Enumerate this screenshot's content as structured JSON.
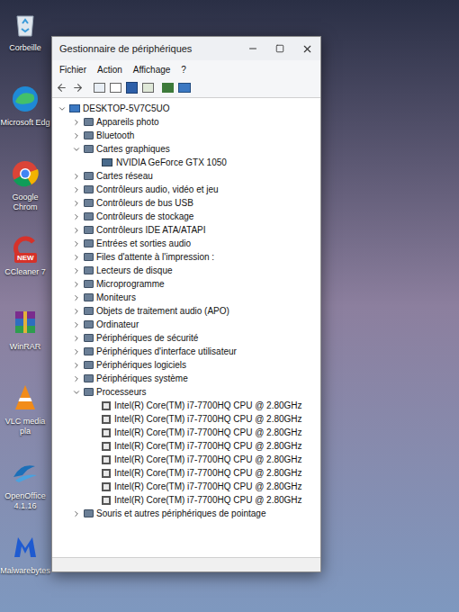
{
  "desktop": {
    "icons": [
      {
        "label": "Corbeille",
        "badge": ""
      },
      {
        "label": "Microsoft Edg",
        "badge": ""
      },
      {
        "label": "Google Chrom",
        "badge": ""
      },
      {
        "label": "CCleaner 7",
        "badge": "NEW"
      },
      {
        "label": "WinRAR",
        "badge": ""
      },
      {
        "label": "VLC media pla",
        "badge": ""
      },
      {
        "label": "OpenOffice 4.1.16",
        "badge": ""
      },
      {
        "label": "Malwarebytes",
        "badge": ""
      }
    ]
  },
  "window": {
    "title": "Gestionnaire de périphériques"
  },
  "menu": [
    "Fichier",
    "Action",
    "Affichage",
    "?"
  ],
  "tree": {
    "label": "DESKTOP-5V7C5UO",
    "expanded": true,
    "children": [
      {
        "label": "Appareils photo",
        "expanded": false,
        "children": []
      },
      {
        "label": "Bluetooth",
        "expanded": false,
        "children": []
      },
      {
        "label": "Cartes graphiques",
        "expanded": true,
        "children": [
          "NVIDIA GeForce GTX 1050"
        ]
      },
      {
        "label": "Cartes réseau",
        "expanded": false,
        "children": []
      },
      {
        "label": "Contrôleurs audio, vidéo et jeu",
        "expanded": false,
        "children": []
      },
      {
        "label": "Contrôleurs de bus USB",
        "expanded": false,
        "children": []
      },
      {
        "label": "Contrôleurs de stockage",
        "expanded": false,
        "children": []
      },
      {
        "label": "Contrôleurs IDE ATA/ATAPI",
        "expanded": false,
        "children": []
      },
      {
        "label": "Entrées et sorties audio",
        "expanded": false,
        "children": []
      },
      {
        "label": "Files d'attente à l'impression :",
        "expanded": false,
        "children": []
      },
      {
        "label": "Lecteurs de disque",
        "expanded": false,
        "children": []
      },
      {
        "label": "Microprogramme",
        "expanded": false,
        "children": []
      },
      {
        "label": "Moniteurs",
        "expanded": false,
        "children": []
      },
      {
        "label": "Objets de traitement audio (APO)",
        "expanded": false,
        "children": []
      },
      {
        "label": "Ordinateur",
        "expanded": false,
        "children": []
      },
      {
        "label": "Périphériques de sécurité",
        "expanded": false,
        "children": []
      },
      {
        "label": "Périphériques d'interface utilisateur",
        "expanded": false,
        "children": []
      },
      {
        "label": "Périphériques logiciels",
        "expanded": false,
        "children": []
      },
      {
        "label": "Périphériques système",
        "expanded": false,
        "children": []
      },
      {
        "label": "Processeurs",
        "expanded": true,
        "children": [
          "Intel(R) Core(TM) i7-7700HQ CPU @ 2.80GHz",
          "Intel(R) Core(TM) i7-7700HQ CPU @ 2.80GHz",
          "Intel(R) Core(TM) i7-7700HQ CPU @ 2.80GHz",
          "Intel(R) Core(TM) i7-7700HQ CPU @ 2.80GHz",
          "Intel(R) Core(TM) i7-7700HQ CPU @ 2.80GHz",
          "Intel(R) Core(TM) i7-7700HQ CPU @ 2.80GHz",
          "Intel(R) Core(TM) i7-7700HQ CPU @ 2.80GHz",
          "Intel(R) Core(TM) i7-7700HQ CPU @ 2.80GHz"
        ]
      },
      {
        "label": "Souris et autres périphériques de pointage",
        "expanded": false,
        "children": []
      }
    ]
  }
}
